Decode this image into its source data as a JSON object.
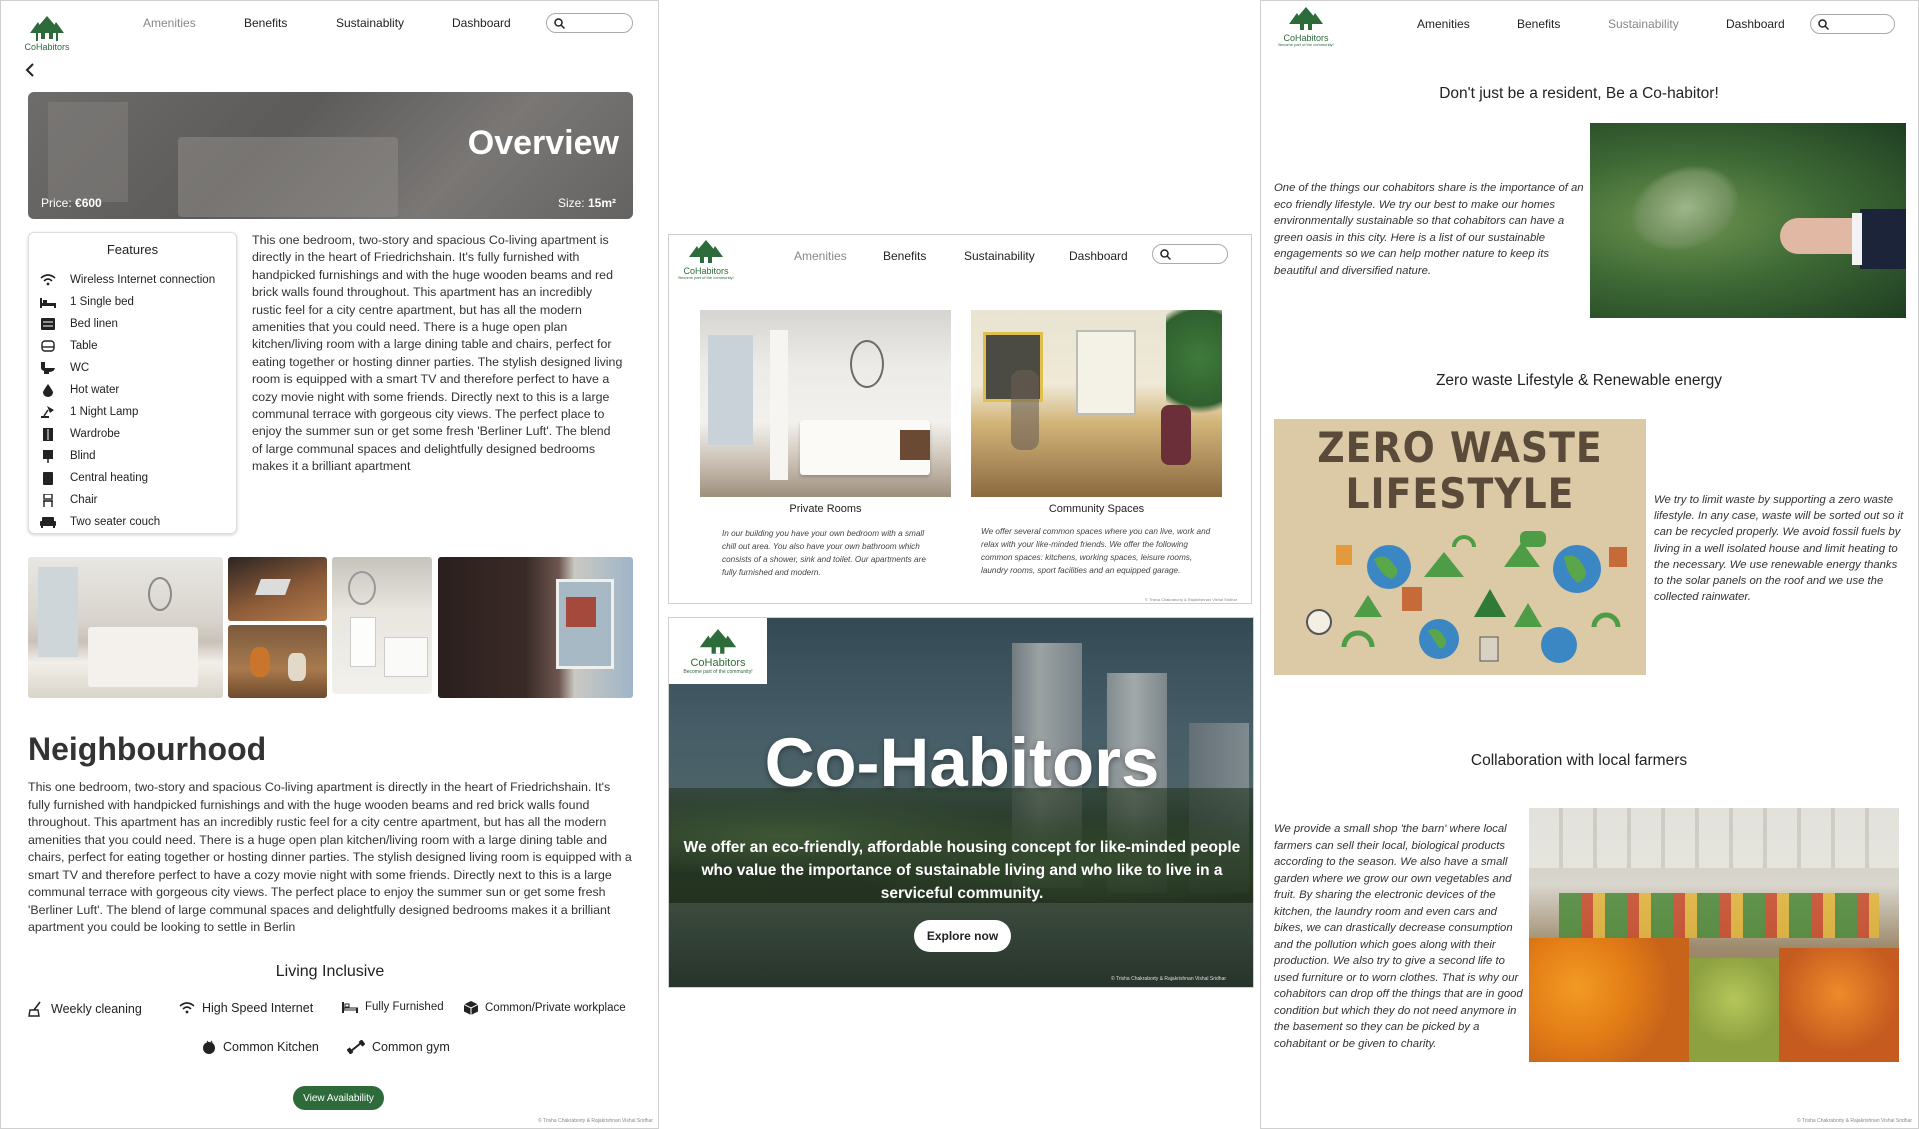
{
  "colors": {
    "brand_green": "#2e6b3a",
    "nav_muted": "#888888"
  },
  "brand": {
    "name": "CoHabitors",
    "tagline": "Become part of the community!"
  },
  "nav": {
    "amenities": "Amenities",
    "benefits": "Benefits",
    "sustainability_left": "Sustainablity",
    "sustainability": "Sustainability",
    "dashboard": "Dashboard",
    "search_icon": "search-icon"
  },
  "overview": {
    "title": "Overview",
    "price_label": "Price:",
    "price_value": "€600",
    "size_label": "Size:",
    "size_value": "15m²",
    "features_title": "Features",
    "features": [
      {
        "icon": "wifi-icon",
        "label": "Wireless Internet connection"
      },
      {
        "icon": "bed-icon",
        "label": "1 Single bed"
      },
      {
        "icon": "linen-icon",
        "label": "Bed linen"
      },
      {
        "icon": "table-icon",
        "label": "Table"
      },
      {
        "icon": "toilet-icon",
        "label": "WC"
      },
      {
        "icon": "water-drop-icon",
        "label": "Hot water"
      },
      {
        "icon": "lamp-icon",
        "label": "1 Night Lamp"
      },
      {
        "icon": "wardrobe-icon",
        "label": "Wardrobe"
      },
      {
        "icon": "blind-icon",
        "label": "Blind"
      },
      {
        "icon": "heater-icon",
        "label": "Central heating"
      },
      {
        "icon": "chair-icon",
        "label": "Chair"
      },
      {
        "icon": "couch-icon",
        "label": "Two seater couch"
      }
    ],
    "description": "This one bedroom, two-story and spacious Co-living apartment is directly in the heart of Friedrichshain. It's fully furnished with handpicked furnishings and with the huge wooden beams and red brick walls found throughout. This apartment has an incredibly rustic feel for a city centre apartment, but has all the modern amenities that you could need. There is a huge open plan kitchen/living room with a large dining table and chairs, perfect for eating together or hosting dinner parties. The stylish designed living room is equipped with a smart TV and therefore perfect to have a cozy movie night with some friends. Directly next to this is a large communal terrace with gorgeous city views. The perfect place to enjoy the summer sun or get some fresh 'Berliner Luft'. The blend of large communal spaces and delightfully designed bedrooms makes it a brilliant apartment"
  },
  "neighbourhood": {
    "title": "Neighbourhood",
    "text": "This one bedroom, two-story and spacious Co-living apartment is directly in the heart of Friedrichshain. It's fully furnished with handpicked furnishings and with the huge wooden beams and red brick walls found throughout. This apartment has an incredibly rustic feel for a city centre apartment, but has all the modern amenities that you could need. There is a huge open plan kitchen/living room with a large dining table and chairs, perfect for eating together or hosting dinner parties. The stylish designed living room is equipped with a smart TV and therefore perfect to have a cozy movie night with some friends. Directly next to this is a large communal terrace with gorgeous city views. The perfect place to enjoy the summer sun or get some fresh 'Berliner Luft'. The blend of large communal spaces and delightfully designed bedrooms makes it a brilliant apartment you could be looking to settle in Berlin"
  },
  "living_inclusive": {
    "title": "Living Inclusive",
    "items": [
      {
        "icon": "cleaning-icon",
        "label": "Weekly cleaning"
      },
      {
        "icon": "wifi-icon",
        "label": "High Speed Internet"
      },
      {
        "icon": "bed-icon",
        "label": "Fully Furnished"
      },
      {
        "icon": "box-icon",
        "label": "Common/Private workplace"
      },
      {
        "icon": "kitchen-icon",
        "label": "Common Kitchen"
      },
      {
        "icon": "dumbbell-icon",
        "label": "Common gym"
      }
    ],
    "cta": "View Availability"
  },
  "copyright": "© Trisha Chakraborty & Rajakrishnan Vishal Sridhar",
  "rooms": {
    "private": {
      "title": "Private Rooms",
      "text": "In our building you have your own bedroom with a small chill out area. You also have your own bathroom which consists of a shower, sink and toilet. Our apartments are fully furnished and modern."
    },
    "community": {
      "title": "Community Spaces",
      "text": "We offer several common spaces where you can live, work and relax with your like-minded friends. We offer the following common spaces: kitchens, working spaces, leisure rooms, laundry rooms, sport facilities and an equipped garage."
    }
  },
  "hero": {
    "title": "Co-Habitors",
    "subtitle": "We offer an eco-friendly, affordable housing concept for like-minded people who value the importance of sustainable living and who like to live in a serviceful community.",
    "cta": "Explore now"
  },
  "sustain": {
    "heading1": "Don't just be a resident, Be a Co-habitor!",
    "text1": "One of the things our cohabitors share is the importance of an eco friendly lifestyle. We try our best to make our homes environmentally sustainable so that cohabitors can have a green oasis in this city. Here is a list of our sustainable engagements so we can help mother nature to keep its beautiful and diversified nature.",
    "heading2": "Zero waste Lifestyle & Renewable energy",
    "poster_line1": "ZERO WASTE",
    "poster_line2": "LIFESTYLE",
    "text2": "We try to limit waste by supporting a zero waste lifestyle. In any case, waste will be sorted out so it can be recycled properly. We avoid fossil fuels by living in a well isolated house and limit heating to the necessary. We use renewable energy thanks to the solar panels on the roof and we use the collected rainwater.",
    "heading3": "Collaboration with local farmers",
    "text3": "We provide a small shop 'the barn' where local farmers can sell their local, biological products according to the season. We also have a small garden where we grow our own vegetables and fruit. By sharing the electronic devices of the kitchen, the laundry room and even cars and bikes, we can drastically decrease consumption and the pollution which goes along with their production. We also try to give a second life to used furniture or to worn clothes. That is why our cohabitors can drop off the things that are in good condition but which they do not need anymore in the basement so they can be picked by a cohabitant or be given to charity."
  }
}
